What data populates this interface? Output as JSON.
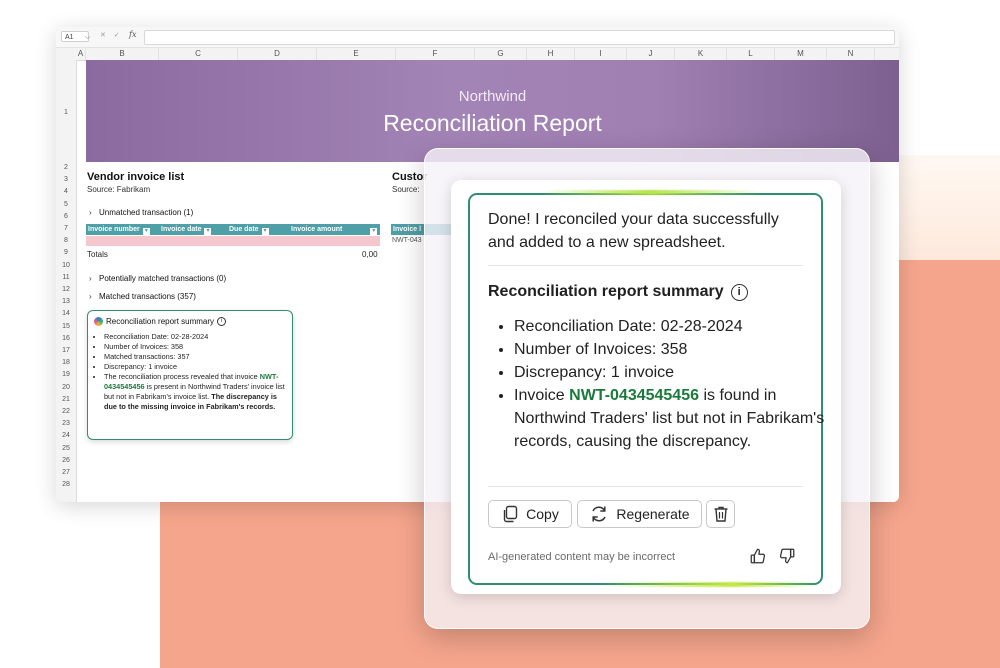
{
  "spreadsheet": {
    "name_box": "A1",
    "formula_icons": "✕ ✓",
    "fx_label": "fx",
    "columns": [
      "A",
      "B",
      "C",
      "D",
      "E",
      "F",
      "G",
      "H",
      "I",
      "J",
      "K",
      "L",
      "M",
      "N"
    ],
    "rows": [
      "1",
      "2",
      "3",
      "4",
      "5",
      "6",
      "7",
      "8",
      "9",
      "10",
      "11",
      "12",
      "13",
      "14",
      "15",
      "16",
      "17",
      "18",
      "19",
      "20",
      "21",
      "22",
      "23",
      "24",
      "25",
      "26",
      "27",
      "28"
    ],
    "banner": {
      "subtitle": "Northwind",
      "title": "Reconciliation Report"
    },
    "vendor": {
      "title": "Vendor invoice list",
      "source": "Source: Fabrikam",
      "unmatched": "Unmatched transaction (1)",
      "headers": [
        "Invoice number",
        "Invoice date",
        "Due date",
        "Invoice amount"
      ],
      "totals_label": "Totals",
      "totals_value": "0,00",
      "potential": "Potentially matched transactions (0)",
      "matched": "Matched transactions (357)"
    },
    "customer": {
      "title": "Custor",
      "source": "Source:",
      "header": "Invoice l",
      "cell": "NWT-043"
    },
    "mini_card": {
      "title": "Reconciliation report summary",
      "items": [
        "Reconciliation Date: 02-28-2024",
        "Number of Invoices: 358",
        "Matched transactions: 357",
        "Discrepancy: 1 invoice"
      ],
      "last_item": {
        "pre": "The reconciliation process revealed that invoice ",
        "invoice": "NWT-0434545456",
        "mid": " is present in Northwind Traders' invoice list but not in Fabrikam's invoice list. ",
        "bold": "The discrepancy is due to the missing invoice in Fabrikam's records."
      }
    }
  },
  "copilot": {
    "message": "Done! I reconciled your data successfully and added to a new spreadsheet.",
    "summary_title": "Reconciliation report summary",
    "info_glyph": "i",
    "items": [
      "Reconciliation Date: 02-28-2024",
      "Number of Invoices: 358",
      "Discrepancy: 1 invoice"
    ],
    "invoice_item": {
      "pre": "Invoice ",
      "invoice": "NWT-0434545456",
      "post": " is found in Northwind Traders' list but not in Fabrikam's records, causing the discrepancy."
    },
    "buttons": {
      "copy": "Copy",
      "regenerate": "Regenerate"
    },
    "footer": "AI-generated content may be incorrect"
  },
  "colors": {
    "accent_green": "#2f8f6e",
    "invoice_green": "#1b7a3a",
    "banner_purple": "#a384b6",
    "table_header_teal": "#4e9fa8",
    "peach_background": "#f5a58c"
  }
}
